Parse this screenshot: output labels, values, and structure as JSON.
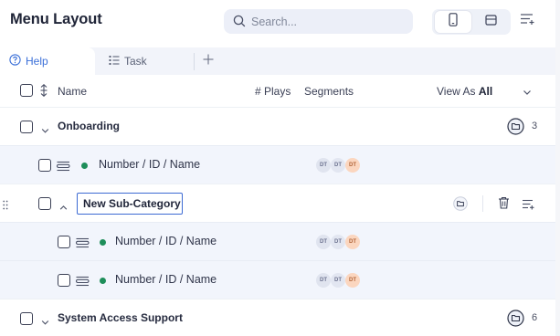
{
  "header": {
    "title": "Menu Layout",
    "search_placeholder": "Search..."
  },
  "tabs": [
    {
      "label": "Help",
      "active": true
    },
    {
      "label": "Task",
      "active": false
    }
  ],
  "columns": {
    "name": "Name",
    "plays": "# Plays",
    "segments": "Segments",
    "view_as_prefix": "View As",
    "view_as_value": "All"
  },
  "rows": [
    {
      "type": "category",
      "label": "Onboarding",
      "expanded": false,
      "count": "3"
    },
    {
      "type": "item",
      "label": "Number / ID / Name",
      "segments": [
        "DT",
        "DT",
        "DT"
      ]
    },
    {
      "type": "category-editing",
      "label": "New Sub-Category",
      "expanded": true
    },
    {
      "type": "item",
      "label": "Number / ID / Name",
      "segments": [
        "DT",
        "DT",
        "DT"
      ]
    },
    {
      "type": "item",
      "label": "Number / ID / Name",
      "segments": [
        "DT",
        "DT",
        "DT"
      ]
    },
    {
      "type": "category",
      "label": "System Access Support",
      "expanded": false,
      "count": "6"
    }
  ],
  "colors": {
    "accent": "#3a6fd8",
    "active_dot": "#1e8e5a",
    "segment_highlight": "#fbd6bf",
    "row_tint": "#f2f5fc"
  },
  "icons": {
    "search": "search-icon",
    "mobile_view": "mobile-icon",
    "desktop_view": "layout-icon",
    "filter": "filter-icon",
    "help": "help-circle-icon",
    "task": "task-list-icon",
    "add": "plus-icon",
    "folder": "folder-icon",
    "trash": "trash-icon",
    "drag": "drag-handle-icon"
  }
}
